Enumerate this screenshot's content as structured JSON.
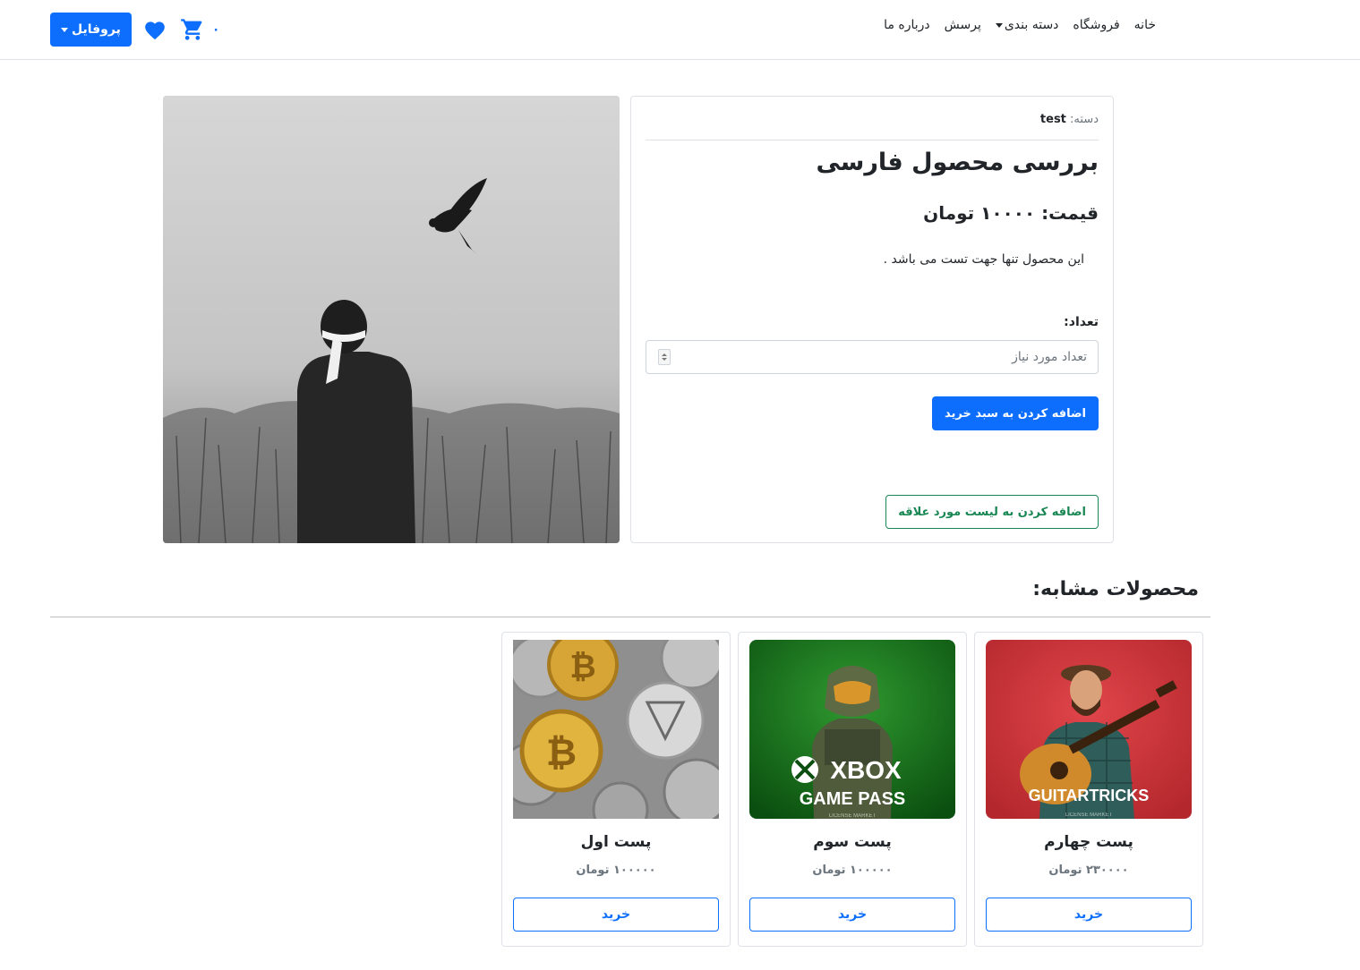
{
  "navbar": {
    "profile_label": "پروفایل",
    "cart_count": "۰",
    "links": [
      {
        "label": "خانه"
      },
      {
        "label": "فروشگاه"
      },
      {
        "label": "دسته بندی"
      },
      {
        "label": "پرسش"
      },
      {
        "label": "درباره ما"
      }
    ]
  },
  "product": {
    "category_label": "دسته:",
    "category_value": "test",
    "title": "بررسی محصول فارسی",
    "price": "قیمت: ۱۰۰۰۰ تومان",
    "description": "این محصول تنها جهت تست می باشد .",
    "quantity_label": "تعداد:",
    "quantity_placeholder": "تعداد مورد نیاز",
    "add_to_cart_label": "اضافه کردن به سبد خرید",
    "add_to_wishlist_label": "اضافه کردن به لیست مورد علاقه"
  },
  "similar": {
    "title": "محصولات مشابه:",
    "items": [
      {
        "name": "پست چهارم",
        "price": "۲۳۰۰۰۰ تومان",
        "buy_label": "خرید",
        "image_text": "GUITARTRICKS",
        "image_subtext": "LICENSE MARKET"
      },
      {
        "name": "پست سوم",
        "price": "۱۰۰۰۰۰ تومان",
        "buy_label": "خرید",
        "image_text": "XBOX",
        "image_text2": "GAME PASS",
        "image_subtext": "LICENSE MARKET"
      },
      {
        "name": "پست اول",
        "price": "۱۰۰۰۰۰ تومان",
        "buy_label": "خرید"
      }
    ]
  },
  "colors": {
    "primary": "#0d6efd",
    "success": "#198754",
    "muted": "#6c757d"
  }
}
